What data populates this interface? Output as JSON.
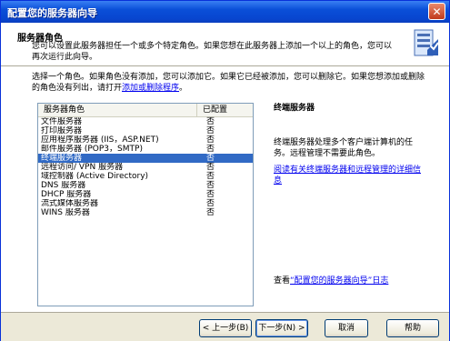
{
  "window": {
    "title": "配置您的服务器向导"
  },
  "header": {
    "title": "服务器角色",
    "description": "您可以设置此服务器担任一个或多个特定角色。如果您想在此服务器上添加一个以上的角色，您可以再次运行此向导。"
  },
  "content": {
    "intro_text": "选择一个角色。如果角色没有添加，您可以添加它。如果它已经被添加，您可以删除它。如果您想添加或删除的角色没有列出，请打开",
    "intro_link": "添加或删除程序",
    "intro_end": "。"
  },
  "role_list": {
    "header_role": "服务器角色",
    "header_status": "已配置",
    "rows": [
      {
        "role": "文件服务器",
        "status": "否"
      },
      {
        "role": "打印服务器",
        "status": "否"
      },
      {
        "role": "应用程序服务器 (IIS，ASP.NET)",
        "status": "否"
      },
      {
        "role": "邮件服务器 (POP3，SMTP)",
        "status": "否"
      },
      {
        "role": "终端服务器",
        "status": "否"
      },
      {
        "role": "远程访问/ VPN 服务器",
        "status": "否"
      },
      {
        "role": "域控制器 (Active Directory)",
        "status": "否"
      },
      {
        "role": "DNS 服务器",
        "status": "否"
      },
      {
        "role": "DHCP 服务器",
        "status": "否"
      },
      {
        "role": "流式媒体服务器",
        "status": "否"
      },
      {
        "role": "WINS 服务器",
        "status": "否"
      }
    ]
  },
  "details": {
    "title": "终端服务器",
    "description": "终端服务器处理多个客户端计算机的任务。远程管理不需要此角色。",
    "more_info_link": "阅读有关终端服务器和远程管理的详细信息",
    "log_text_prefix": "查看",
    "log_link": "“配置您的服务器向导”日志"
  },
  "buttons": {
    "back": "< 上一步(B)",
    "next": "下一步(N) >",
    "cancel": "取消",
    "help": "帮助"
  }
}
